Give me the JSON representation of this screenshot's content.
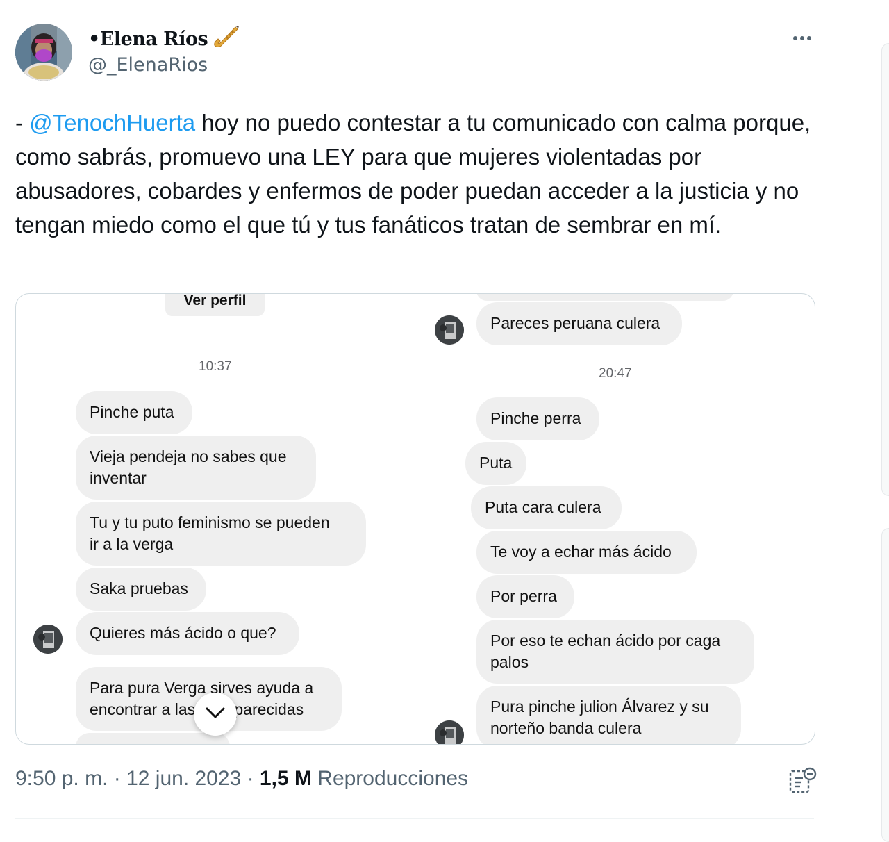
{
  "author": {
    "name": "•Elena Ríos",
    "handle": "@_ElenaRios"
  },
  "tweet": {
    "prefix": "- ",
    "mention": "@TenochHuerta",
    "body": " hoy no puedo contestar a tu comunicado con calma porque, como sabrás, promuevo una LEY para que mujeres violentadas por abusadores, cobardes y enfermos de poder puedan acceder a la justicia y no tengan miedo como el que tú y tus fanáticos tratan de sembrar en mí."
  },
  "media": {
    "left": {
      "ver_perfil": "Ver perfil",
      "time": "10:37",
      "messages": [
        "Pinche puta",
        "Vieja pendeja no sabes que\ninventar",
        "Tu y tu puto feminismo se pueden\nir a la verga",
        "Saka pruebas",
        "Quieres más ácido o que?",
        "Para pura Verga sirves ayuda a\nencontrar a las desaparecidas"
      ]
    },
    "right": {
      "top_message": "Pareces peruana culera",
      "time": "20:47",
      "messages": [
        "Pinche perra",
        "Puta",
        "Puta cara culera",
        "Te voy a echar más ácido",
        "Por perra",
        "Por eso te echan ácido por caga\npalos",
        "Pura pinche julion Álvarez y su\nnorteño banda culera"
      ]
    }
  },
  "footer": {
    "time": "9:50 p. m.",
    "sep1": " · ",
    "date": "12 jun. 2023",
    "sep2": " · ",
    "views_count": "1,5 M",
    "views_label": " Reproducciones"
  },
  "colors": {
    "mention": "#1d9bf0",
    "secondary_text": "#536471",
    "bubble": "#efefef"
  },
  "icons": [
    "saxophone-icon",
    "more-icon",
    "chevron-down-icon",
    "analytics-icon"
  ]
}
